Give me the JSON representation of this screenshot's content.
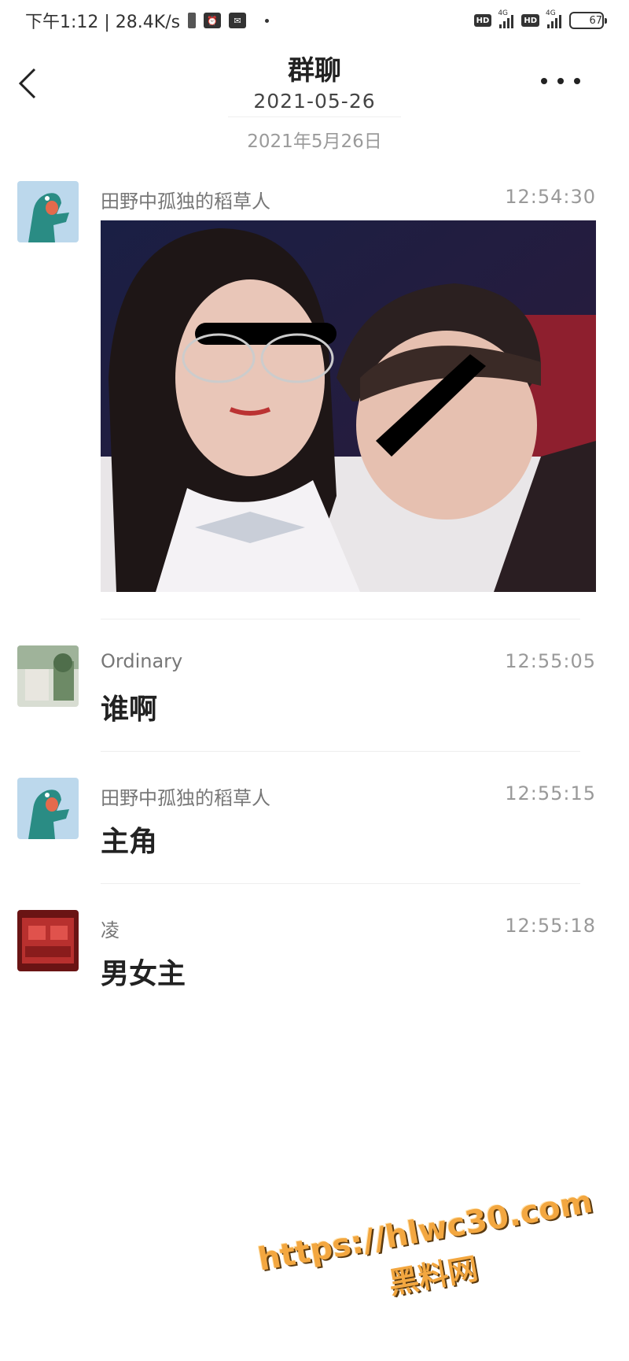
{
  "status_bar": {
    "time_speed": "下午1:12 | 28.4K/s",
    "hd1": "HD",
    "net1": "4G",
    "hd2": "HD",
    "net2": "4G",
    "battery": "67",
    "battery_level": 0.67
  },
  "header": {
    "title": "群聊",
    "subtitle": "2021-05-26"
  },
  "date_separator": "2021年5月26日",
  "messages": [
    {
      "sender": "田野中孤独的稻草人",
      "time": "12:54:30",
      "type": "image"
    },
    {
      "sender": "Ordinary",
      "time": "12:55:05",
      "text": "谁啊"
    },
    {
      "sender": "田野中孤独的稻草人",
      "time": "12:55:15",
      "text": "主角"
    },
    {
      "sender": "凌",
      "time": "12:55:18",
      "text": "男女主"
    }
  ],
  "watermark": {
    "url": "https://hlwc30.com",
    "name": "黑料网"
  },
  "colors": {
    "accent_watermark": "#f3a740",
    "avatar_teal": "#2a8c84",
    "avatar_red": "#b8302e"
  }
}
